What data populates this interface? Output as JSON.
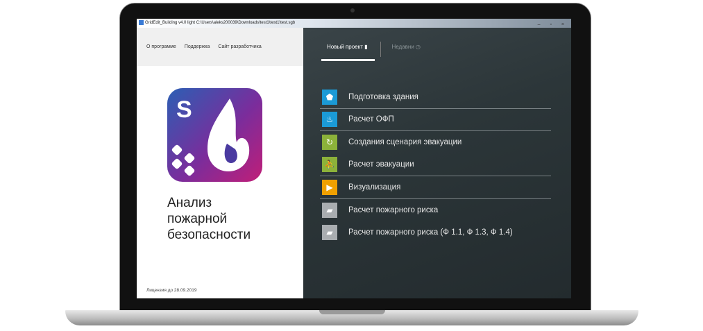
{
  "window": {
    "title": "GridEdit_Building v4.0 light C:\\Users\\aleks200039\\Downloads\\test1\\test1\\test.sgb",
    "controls": "– ▫ ×"
  },
  "left_nav": [
    "О программе",
    "Поддержка",
    "Сайт разработчика"
  ],
  "logo_letter": "S",
  "app_title": [
    "Анализ",
    "пожарной",
    "безопасности"
  ],
  "license": "Лицензия до 28.09.2019",
  "tabs": [
    {
      "label": "Новый проект",
      "icon": "book-icon",
      "active": true
    },
    {
      "label": "Недавни",
      "icon": "clock-icon",
      "active": false
    }
  ],
  "menu": [
    {
      "label": "Подготовка здания",
      "icon": "building-icon",
      "color": "#1b9ad6"
    },
    {
      "label": "Расчет ОФП",
      "icon": "fire-spread-icon",
      "color": "#1b9ad6"
    },
    {
      "label": "Создания сценария эвакуации",
      "icon": "cycle-icon",
      "color": "#8cb23a"
    },
    {
      "label": "Расчет эвакуации",
      "icon": "running-man-icon",
      "color": "#8cb23a"
    },
    {
      "label": "Визуализация",
      "icon": "film-icon",
      "color": "#f0a000"
    },
    {
      "label": "Расчет пожарного риска",
      "icon": "folder-icon",
      "color": "#a9adb0"
    },
    {
      "label": "Расчет пожарного риска (Ф 1.1, Ф 1.3, Ф 1.4)",
      "icon": "folder-icon",
      "color": "#a9adb0"
    }
  ]
}
